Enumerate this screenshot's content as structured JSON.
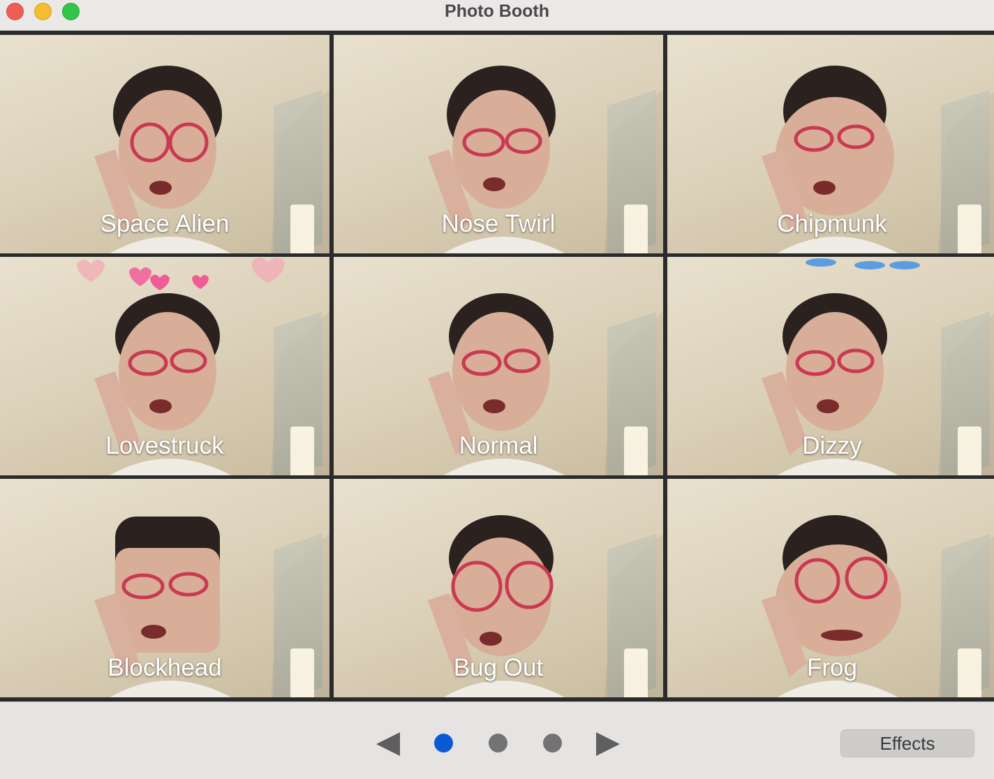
{
  "window": {
    "title": "Photo Booth"
  },
  "effects_grid": {
    "tiles": [
      {
        "label": "Space Alien"
      },
      {
        "label": "Nose Twirl"
      },
      {
        "label": "Chipmunk"
      },
      {
        "label": "Lovestruck"
      },
      {
        "label": "Normal"
      },
      {
        "label": "Dizzy"
      },
      {
        "label": "Blockhead"
      },
      {
        "label": "Bug Out"
      },
      {
        "label": "Frog"
      }
    ]
  },
  "toolbar": {
    "pages": 3,
    "current_page": 1,
    "effects_label": "Effects",
    "accent_color": "#0a5bd3"
  },
  "icons": {
    "prev": "triangle-left-icon",
    "next": "triangle-right-icon",
    "hearts": "hearts-icon",
    "birds": "birds-icon"
  }
}
